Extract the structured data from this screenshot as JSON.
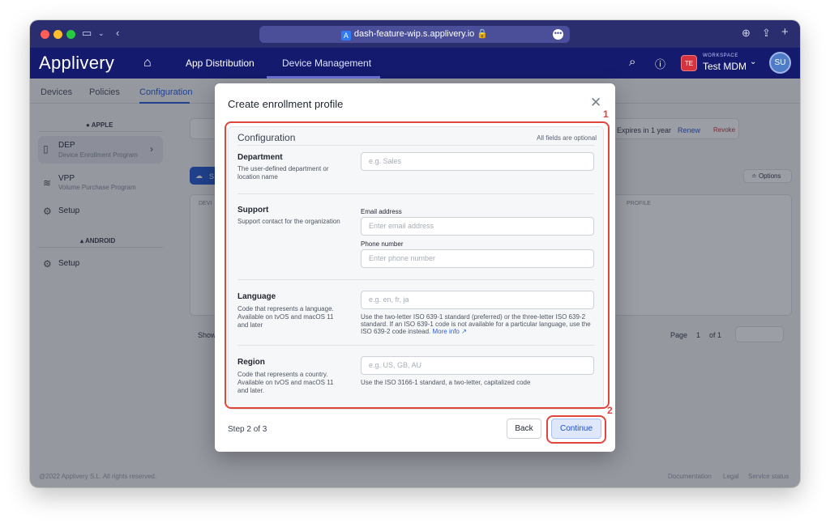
{
  "browser": {
    "url": "dash-feature-wip.s.applivery.io",
    "traffic_colors": [
      "#ff5f57",
      "#febc2e",
      "#28c840"
    ]
  },
  "app": {
    "logo": "Applivery",
    "nav": [
      "App Distribution",
      "Device Management"
    ],
    "workspace_label": "WORKSPACE",
    "workspace_badge": "TE",
    "workspace_name": "Test MDM",
    "avatar": "SU"
  },
  "subtabs": [
    "Devices",
    "Policies",
    "Configuration"
  ],
  "sidebar": {
    "apple_head": "APPLE",
    "dep_title": "DEP",
    "dep_sub": "Device Enrollment Program",
    "vpp_title": "VPP",
    "vpp_sub": "Volume Purchase Program",
    "setup": "Setup",
    "android_head": "ANDROID",
    "setup2": "Setup"
  },
  "background": {
    "expires": "Expires in 1 year",
    "renew": "Renew",
    "revoke": "Revoke",
    "options": "Options",
    "col_device": "DEVI",
    "col_profile": "PROFILE",
    "show": "Show",
    "page_label": "Page",
    "page_num": "1",
    "page_of": "of 1",
    "btn_s": "S"
  },
  "footer": {
    "copyright": "@2022 Applivery S.L. All rights reserved.",
    "documentation": "Documentation",
    "legal": "Legal",
    "status": "Service status"
  },
  "modal": {
    "title": "Create enrollment profile",
    "config_title": "Configuration",
    "config_note": "All fields are optional",
    "department": {
      "title": "Department",
      "desc": "The user-defined department or location name",
      "placeholder": "e.g. Sales"
    },
    "support": {
      "title": "Support",
      "desc": "Support contact for the organization",
      "email_label": "Email address",
      "email_placeholder": "Enter email address",
      "phone_label": "Phone number",
      "phone_placeholder": "Enter phone number"
    },
    "language": {
      "title": "Language",
      "desc": "Code that represents a language. Available on tvOS and macOS 11 and later",
      "placeholder": "e.g. en, fr, ja",
      "help": "Use the two-letter ISO 639-1 standard (preferred) or the three-letter ISO 639-2 standard. If an ISO 639-1 code is not available for a particular language, use the ISO 639-2 code instead.",
      "help_link": "More info"
    },
    "region": {
      "title": "Region",
      "desc": "Code that represents a country. Available on tvOS and macOS 11 and later.",
      "placeholder": "e.g. US, GB, AU",
      "help": "Use the ISO 3166-1 standard, a two-letter, capitalized code"
    },
    "step": "Step 2 of 3",
    "back": "Back",
    "continue": "Continue"
  },
  "annotations": [
    "1",
    "2"
  ]
}
